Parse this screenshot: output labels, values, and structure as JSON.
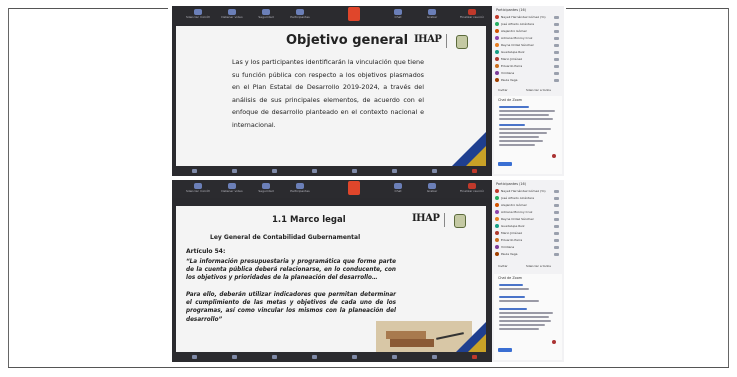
{
  "toolbar": {
    "items": [
      "Silenciar micrófono",
      "Detener video",
      "Seguridad",
      "Participantes",
      "Chat",
      "Grabar",
      "Reacciones",
      "Finalizar reunión"
    ],
    "share_label": "Compartir pantalla"
  },
  "participants": {
    "title": "Participantes (16)",
    "names": [
      "Nayeli Hernández Gómez (Yo)",
      "José Alfredo Alcántara",
      "Alejandro Gómez",
      "Adriana Monroy Cruz",
      "Reyna Ordaz Sánchez",
      "Guadalupe Ruiz",
      "Mario Jiménez",
      "Eduardo Parra",
      "Viridiana",
      "Paula Vega"
    ],
    "avatar_colors": [
      "#c0392b",
      "#27ae60",
      "#d35400",
      "#8e44ad",
      "#e67e22",
      "#16a085",
      "#b03a2e",
      "#ca6f1e",
      "#7d3c98",
      "#a04000"
    ],
    "invite_label": "Invitar",
    "mute_label": "Silenciar a todos"
  },
  "chat": {
    "title": "Chat de Zoom",
    "send_label": "Enviar"
  },
  "slide1": {
    "title": "Objetivo general",
    "paragraph": "Las y los participantes identificarán la vinculación que tiene su función pública con respecto a los objetivos plasmados en el Plan Estatal de Desarrollo 2019-2024, a través del análisis de sus principales elementos, de acuerdo con el enfoque de desarrollo planteado en el contexto nacional e internacional.",
    "logo_text": "IHAP",
    "logo_sub": "Instituto Hacendario del Estado de Puebla"
  },
  "slide2": {
    "title": "1.1 Marco legal",
    "subtitle": "Ley General de Contabilidad Gubernamental",
    "article": "Artículo 54:",
    "quote": "“La información presupuestaria y programática que forme parte de la cuenta pública deberá relacionarse, en lo conducente, con los objetivos y prioridades de la planeación del desarrollo…",
    "quote2": "Para ello, deberán utilizar indicadores que permitan determinar el cumplimiento de las metas y objetivos de cada uno de los programas, así como vincular los mismos con la planeación del desarrollo”",
    "logo_text": "IHAP",
    "logo_sub": "Instituto Hacendario del Estado de Puebla"
  },
  "colors": {
    "stripe_blue": "#1f3f8f",
    "stripe_gold": "#c9a227",
    "share_red": "#e0462b",
    "toolbar": "#2b2b2f"
  }
}
